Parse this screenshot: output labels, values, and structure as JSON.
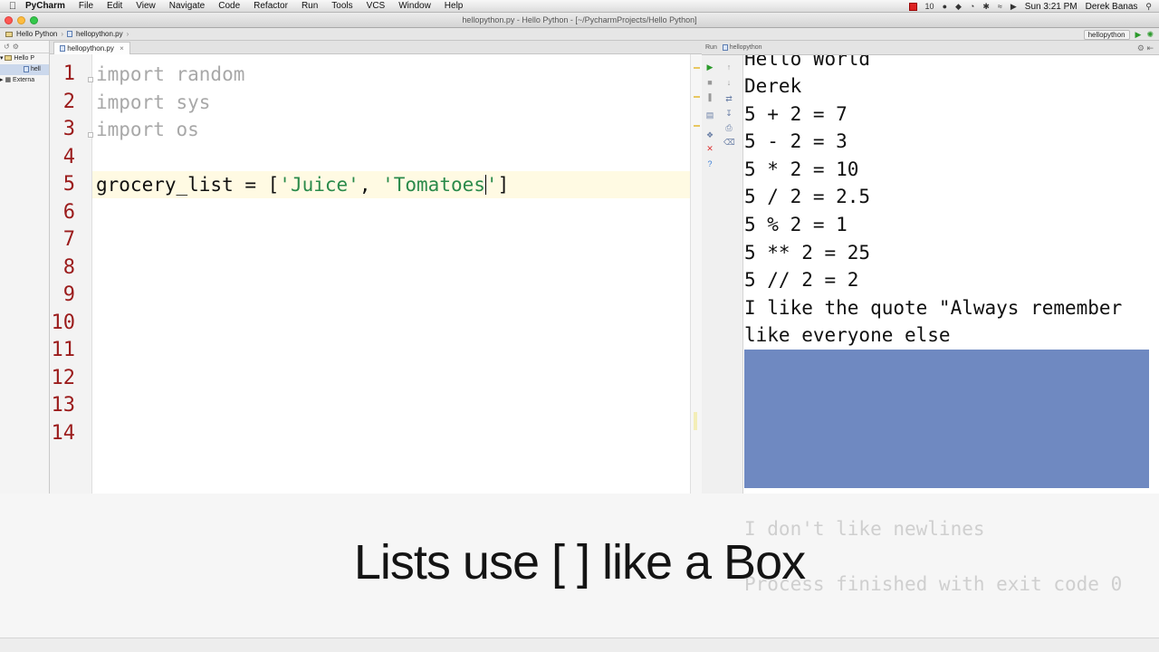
{
  "menubar": {
    "app_name": "PyCharm",
    "items": [
      "File",
      "Edit",
      "View",
      "Navigate",
      "Code",
      "Refactor",
      "Run",
      "Tools",
      "VCS",
      "Window",
      "Help"
    ],
    "clock": "Sun 3:21 PM",
    "user": "Derek Banas",
    "status_num": "10"
  },
  "window": {
    "title": "hellopython.py - Hello Python - [~/PycharmProjects/Hello Python]"
  },
  "navbar": {
    "project": "Hello Python",
    "file": "hellopython.py",
    "run_config": "hellopython"
  },
  "project_tree": {
    "items": [
      "Hello P",
      "hell",
      "Externa"
    ]
  },
  "editor": {
    "tab_label": "hellopython.py",
    "line_numbers": [
      "1",
      "2",
      "3",
      "4",
      "5",
      "6",
      "7",
      "8",
      "9",
      "10",
      "11",
      "12",
      "13",
      "14"
    ],
    "lines": {
      "l1": "import random",
      "l2": "import sys",
      "l3": "import os",
      "l5_prefix": "grocery_list = [",
      "l5_str1": "'Juice'",
      "l5_mid": ", ",
      "l5_str2a": "'Tomatoes",
      "l5_str2b": "'",
      "l5_suffix": "]"
    }
  },
  "run_panel": {
    "header_run": "Run",
    "header_config": "hellopython",
    "output": [
      "Hello World",
      "Derek",
      "5 + 2 = 7",
      "5 - 2 = 3",
      "5 * 2 = 10",
      "5 / 2 = 2.5",
      "5 % 2 = 1",
      "5 ** 2 = 25",
      "5 // 2 = 2",
      "I like the quote \"Always remember",
      "like everyone else"
    ],
    "ghost_output": [
      "I don't like newlines",
      "Process finished with exit code 0"
    ]
  },
  "caption": "Lists use [ ] like a Box"
}
